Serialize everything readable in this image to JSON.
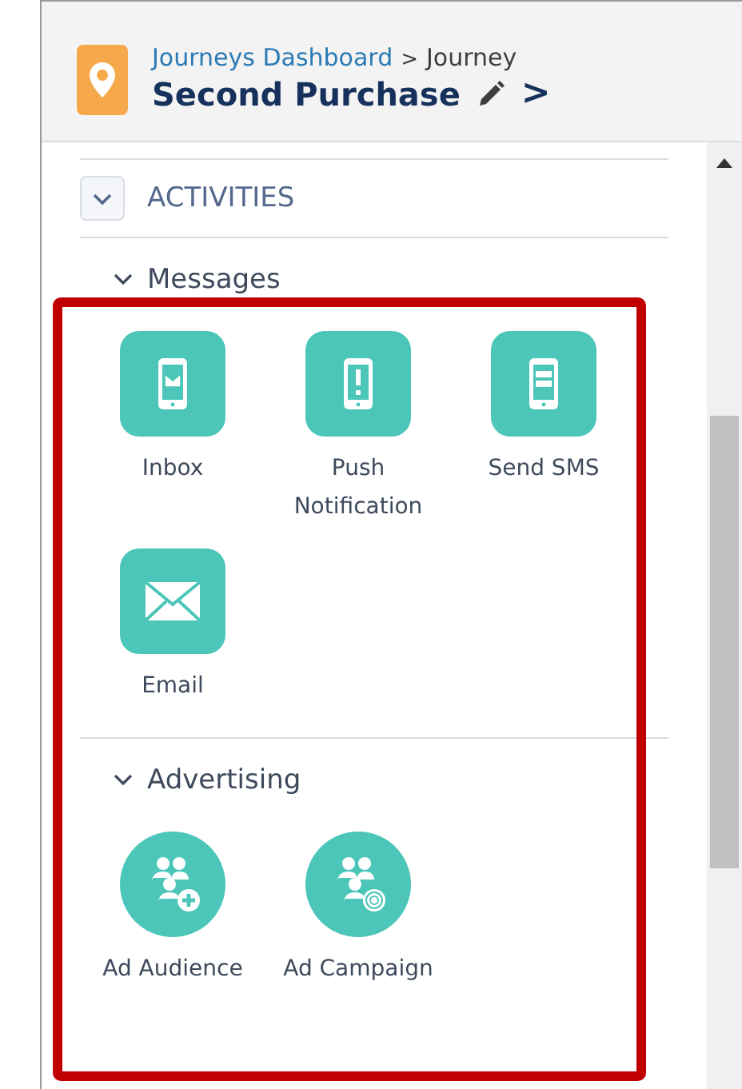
{
  "header": {
    "breadcrumb_link": "Journeys Dashboard",
    "breadcrumb_separator": ">",
    "breadcrumb_current": "Journey",
    "title": "Second Purchase",
    "next": ">"
  },
  "panel": {
    "title": "ACTIVITIES",
    "expanded": true
  },
  "groups": [
    {
      "name": "Messages",
      "expanded": true,
      "items": [
        {
          "label": "Inbox",
          "kind": "inbox"
        },
        {
          "label": "Push Notification",
          "kind": "push"
        },
        {
          "label": "Send SMS",
          "kind": "sms"
        },
        {
          "label": "Email",
          "kind": "email"
        }
      ]
    },
    {
      "name": "Advertising",
      "expanded": true,
      "items": [
        {
          "label": "Ad Audience",
          "kind": "audience"
        },
        {
          "label": "Ad Campaign",
          "kind": "campaign"
        }
      ]
    }
  ]
}
